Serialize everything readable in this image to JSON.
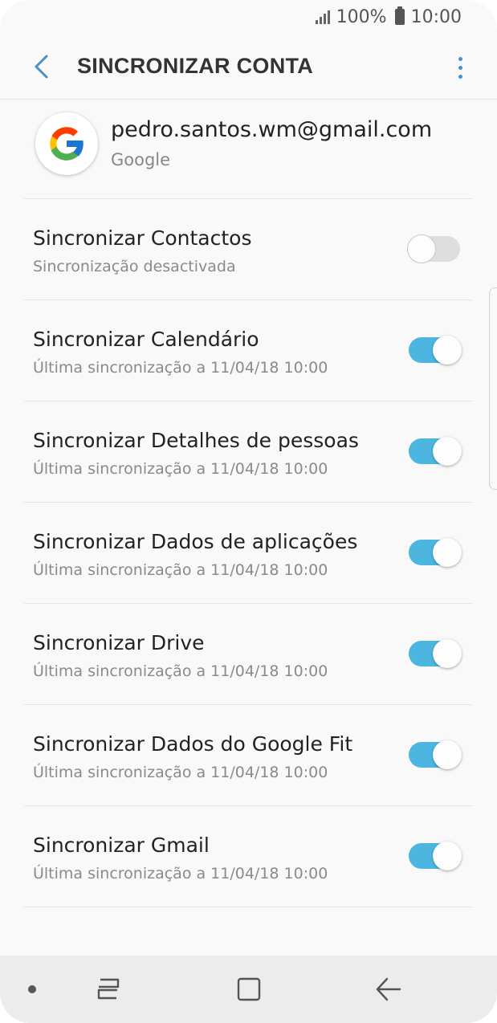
{
  "status_bar": {
    "battery": "100%",
    "time": "10:00"
  },
  "header": {
    "title": "SINCRONIZAR CONTA",
    "accent_color": "#4a90c8"
  },
  "account": {
    "email": "pedro.santos.wm@gmail.com",
    "type": "Google"
  },
  "sync_items": [
    {
      "label": "Sincronizar Contactos",
      "status": "Sincronização desactivada",
      "enabled": false
    },
    {
      "label": "Sincronizar Calendário",
      "status": "Última sincronização a 11/04/18  10:00",
      "enabled": true
    },
    {
      "label": "Sincronizar Detalhes de pessoas",
      "status": "Última sincronização a 11/04/18  10:00",
      "enabled": true
    },
    {
      "label": "Sincronizar Dados de aplicações",
      "status": "Última sincronização a 11/04/18  10:00",
      "enabled": true
    },
    {
      "label": "Sincronizar Drive",
      "status": "Última sincronização a 11/04/18  10:00",
      "enabled": true
    },
    {
      "label": "Sincronizar Dados do Google Fit",
      "status": "Última sincronização a 11/04/18  10:00",
      "enabled": true
    },
    {
      "label": "Sincronizar Gmail",
      "status": "Última sincronização a 11/04/18  10:00",
      "enabled": true
    }
  ],
  "colors": {
    "toggle_on": "#4db6e0",
    "toggle_off": "#dedede"
  },
  "icons": {
    "back": "back-arrow-icon",
    "more": "more-vertical-icon",
    "account": "google-logo-icon",
    "nav_recents": "recents-icon",
    "nav_home": "home-icon",
    "nav_back": "back-icon"
  }
}
